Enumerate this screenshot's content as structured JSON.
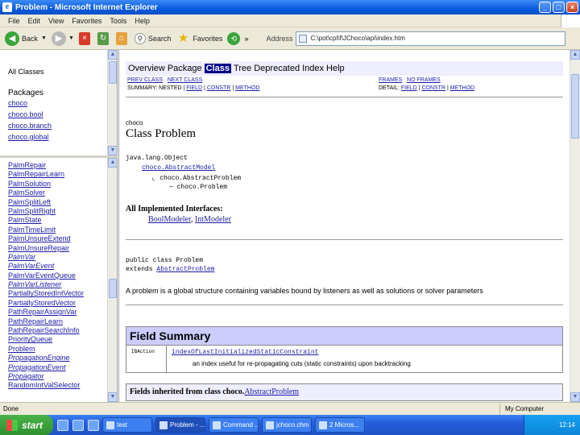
{
  "window": {
    "title": "Problem - Microsoft Internet Explorer",
    "app_icon": "ie-icon",
    "controls": [
      "_",
      "□",
      "×"
    ]
  },
  "menu": [
    "File",
    "Edit",
    "View",
    "Favorites",
    "Tools",
    "Help"
  ],
  "toolbar": {
    "back": "Back",
    "search": "Search",
    "favorites": "Favorites",
    "more": "»",
    "address_label": "Address",
    "address_value": "C:\\pot\\cpl\\f\\JChoco\\api\\index.htm"
  },
  "left_top": {
    "all_classes": "All Classes",
    "packages_heading": "Packages",
    "packages": [
      "choco",
      "choco.bool",
      "choco.branch",
      "choco.global"
    ]
  },
  "left_bottom": {
    "classes": [
      {
        "name": "PalmRepair",
        "italic": false
      },
      {
        "name": "PalmRepairLearn",
        "italic": false
      },
      {
        "name": "PalmSolution",
        "italic": false
      },
      {
        "name": "PalmSolver",
        "italic": false
      },
      {
        "name": "PalmSplitLeft",
        "italic": false
      },
      {
        "name": "PalmSplitRight",
        "italic": false
      },
      {
        "name": "PalmState",
        "italic": false
      },
      {
        "name": "PalmTimeLimit",
        "italic": false
      },
      {
        "name": "PalmUnsureExtend",
        "italic": false
      },
      {
        "name": "PalmUnsureRepair",
        "italic": false
      },
      {
        "name": "PalmVar",
        "italic": true
      },
      {
        "name": "PalmVarEvent",
        "italic": true
      },
      {
        "name": "PalmVarEventQueue",
        "italic": false
      },
      {
        "name": "PalmVarListener",
        "italic": true
      },
      {
        "name": "PartiallyStoredIntVector",
        "italic": false
      },
      {
        "name": "PartiallyStoredVector",
        "italic": false
      },
      {
        "name": "PathRepairAssignVar",
        "italic": false
      },
      {
        "name": "PathRepairLearn",
        "italic": false
      },
      {
        "name": "PathRepairSearchInfo",
        "italic": false
      },
      {
        "name": "PriorityQueue",
        "italic": false
      },
      {
        "name": "Problem",
        "italic": false
      },
      {
        "name": "PropagationEngine",
        "italic": true
      },
      {
        "name": "PropagationEvent",
        "italic": true
      },
      {
        "name": "Propagator",
        "italic": true
      },
      {
        "name": "RandomIntValSelector",
        "italic": false
      }
    ]
  },
  "main": {
    "nav": [
      "Overview",
      "Package",
      "Class",
      "Tree",
      "Deprecated",
      "Index",
      "Help"
    ],
    "nav_current": "Class",
    "subnav_left_1": [
      "PREV CLASS",
      "NEXT CLASS"
    ],
    "subnav_right_1": [
      "FRAMES",
      "NO FRAMES"
    ],
    "subnav_left_2_prefix": "SUMMARY: NESTED |",
    "subnav_left_2": [
      "FIELD",
      "CONSTR",
      "METHOD"
    ],
    "subnav_right_2_prefix": "DETAIL:",
    "subnav_right_2": [
      "FIELD",
      "CONSTR",
      "METHOD"
    ],
    "package": "choco",
    "class_title": "Class Problem",
    "tree": [
      "java.lang.Object",
      "choco.AbstractModel",
      "choco.AbstractProblem",
      "choco.Problem"
    ],
    "interfaces_heading": "All Implemented Interfaces:",
    "interfaces": [
      "BoolModeler",
      "IntModeler"
    ],
    "declaration": "public class Problem",
    "extends_prefix": "extends",
    "extends_link": "AbstractProblem",
    "description": "A problem is a global structure containing variables bound by listeners as well as solutions or solver parameters",
    "field_summary_heading": "Field Summary",
    "field_type": "IBAction",
    "field_name": "indexOfLastInitializedStaticConstraint",
    "field_desc": "an index useful for re-propagating cuts (static constraints) upon backtracking",
    "inherited_prefix": "Fields inherited from class choco.",
    "inherited_link": "AbstractProblem"
  },
  "status": {
    "text": "Done",
    "zone": "My Computer"
  },
  "taskbar": {
    "start": "start",
    "tasks": [
      "test",
      "Problem - ...",
      "Command ...",
      "jchoco.chm",
      "2 Micros..."
    ],
    "clock": "12:14"
  }
}
